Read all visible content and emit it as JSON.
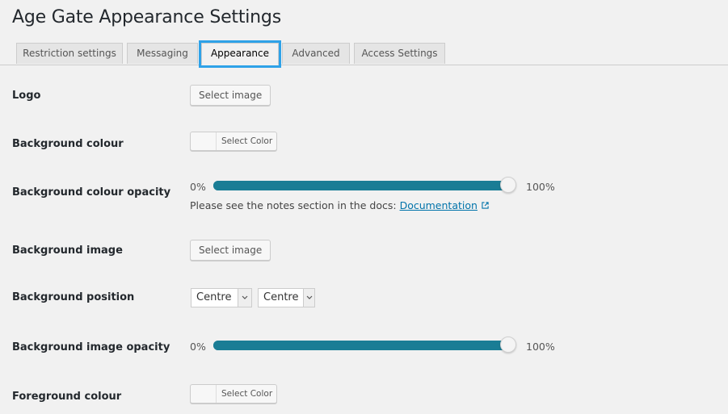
{
  "page": {
    "title": "Age Gate Appearance Settings"
  },
  "tabs": [
    {
      "label": "Restriction settings",
      "active": false
    },
    {
      "label": "Messaging",
      "active": false
    },
    {
      "label": "Appearance",
      "active": true
    },
    {
      "label": "Advanced",
      "active": false
    },
    {
      "label": "Access Settings",
      "active": false
    }
  ],
  "fields": {
    "logo": {
      "label": "Logo",
      "button": "Select image"
    },
    "background_colour": {
      "label": "Background colour",
      "button": "Select Color"
    },
    "background_colour_opacity": {
      "label": "Background colour opacity",
      "min_label": "0%",
      "max_label": "100%",
      "value": 1.0,
      "note_text": "Please see the notes section in the docs:",
      "note_link": "Documentation"
    },
    "background_image": {
      "label": "Background image",
      "button": "Select image"
    },
    "background_position": {
      "label": "Background position",
      "x_value": "Centre",
      "y_value": "Centre"
    },
    "background_image_opacity": {
      "label": "Background image opacity",
      "min_label": "0%",
      "max_label": "100%",
      "value": 1.0
    },
    "foreground_colour": {
      "label": "Foreground colour",
      "button": "Select Color"
    }
  },
  "colors": {
    "slider_track": "#1a7d95",
    "tab_highlight": "#2ea2e8",
    "link": "#0073aa"
  },
  "icons": {
    "external_link": "external-link-icon",
    "select_arrow": "chevron-down-icon"
  }
}
